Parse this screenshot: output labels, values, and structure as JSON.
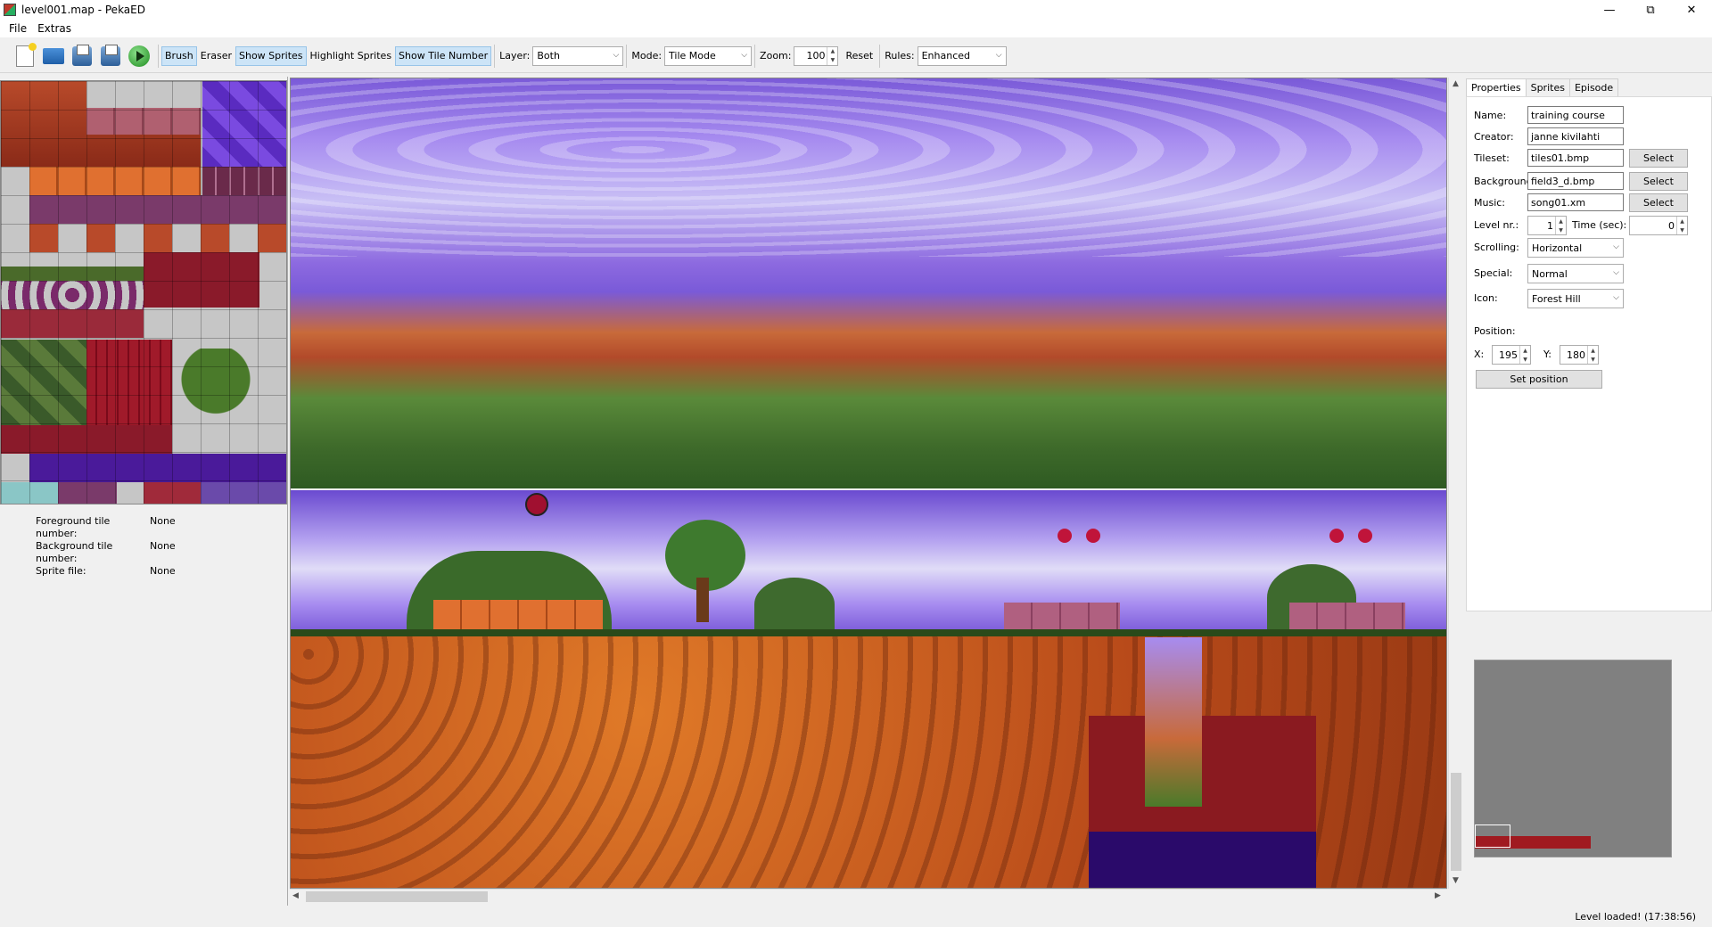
{
  "window": {
    "title": "level001.map - PekaED"
  },
  "menu": [
    "File",
    "Extras"
  ],
  "toolbar": {
    "brush": "Brush",
    "eraser": "Eraser",
    "show_sprites": "Show Sprites",
    "highlight_sprites": "Highlight Sprites",
    "show_tile_number": "Show Tile Number",
    "layer_label": "Layer:",
    "layer_value": "Both",
    "mode_label": "Mode:",
    "mode_value": "Tile Mode",
    "zoom_label": "Zoom:",
    "zoom_value": "100",
    "reset": "Reset",
    "rules_label": "Rules:",
    "rules_value": "Enhanced"
  },
  "tile_info": {
    "fg_label": "Foreground tile number:",
    "fg_value": "None",
    "bg_label": "Background tile number:",
    "bg_value": "None",
    "sprite_label": "Sprite file:",
    "sprite_value": "None"
  },
  "props": {
    "tabs": [
      "Properties",
      "Sprites",
      "Episode"
    ],
    "name_label": "Name:",
    "name_value": "training course",
    "creator_label": "Creator:",
    "creator_value": "janne kivilahti",
    "tileset_label": "Tileset:",
    "tileset_value": "tiles01.bmp",
    "background_label": "Background:",
    "background_value": "field3_d.bmp",
    "music_label": "Music:",
    "music_value": "song01.xm",
    "select": "Select",
    "level_label": "Level nr.:",
    "level_value": "1",
    "time_label": "Time (sec):",
    "time_value": "0",
    "scrolling_label": "Scrolling:",
    "scrolling_value": "Horizontal",
    "special_label": "Special:",
    "special_value": "Normal",
    "icon_label": "Icon:",
    "icon_value": "Forest Hill",
    "position_label": "Position:",
    "x_label": "X:",
    "x_value": "195",
    "y_label": "Y:",
    "y_value": "180",
    "set_position": "Set position"
  },
  "status": "Level loaded! (17:38:56)"
}
